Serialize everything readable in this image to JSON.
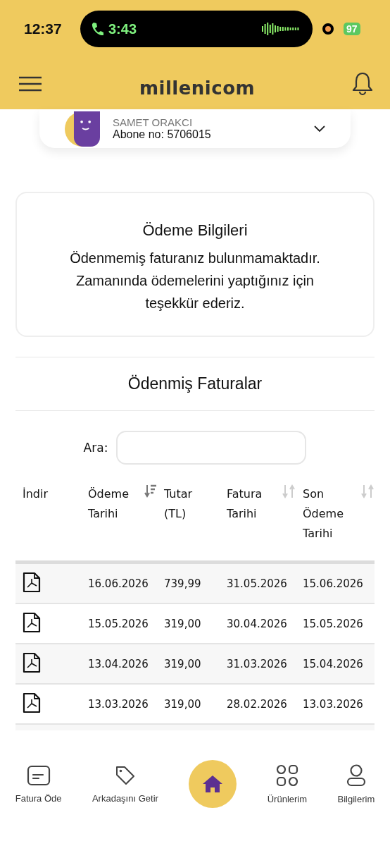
{
  "status_bar": {
    "time": "12:37",
    "call_time": "3:43",
    "battery": "97"
  },
  "header": {
    "logo": "millenicom"
  },
  "account": {
    "name": "SAMET ORAKCI",
    "subscriber": "Abone no: 5706015"
  },
  "payment_info": {
    "title": "Ödeme Bilgileri",
    "message": "Ödenmemiş faturanız bulunmamaktadır. Zamanında ödemelerini yaptığınız için teşekkür ederiz."
  },
  "paid_invoices": {
    "title": "Ödenmiş Faturalar",
    "search": {
      "label": "Ara:"
    },
    "columns": [
      {
        "label": "İndir"
      },
      {
        "label": "Ödeme Tarihi",
        "sorted": true
      },
      {
        "label": "Tutar (TL)"
      },
      {
        "label": "Fatura Tarihi",
        "sorted": false
      },
      {
        "label": "Son Ödeme Tarihi",
        "sorted": false
      }
    ],
    "rows": [
      {
        "payment_date": "16.06.2026",
        "amount": "739,99",
        "invoice_date": "31.05.2026",
        "due_date": "15.06.2026"
      },
      {
        "payment_date": "15.05.2026",
        "amount": "319,00",
        "invoice_date": "30.04.2026",
        "due_date": "15.05.2026"
      },
      {
        "payment_date": "13.04.2026",
        "amount": "319,00",
        "invoice_date": "31.03.2026",
        "due_date": "15.04.2026"
      },
      {
        "payment_date": "13.03.2026",
        "amount": "319,00",
        "invoice_date": "28.02.2026",
        "due_date": "13.03.2026"
      }
    ]
  },
  "bottom_nav": [
    {
      "label": "Fatura Öde",
      "selected": false
    },
    {
      "label": "Arkadaşını Getir",
      "selected": false
    },
    {
      "selected": true
    },
    {
      "label": "Ürünlerim",
      "selected": false
    },
    {
      "label": "Bilgilerim",
      "selected": false
    }
  ]
}
